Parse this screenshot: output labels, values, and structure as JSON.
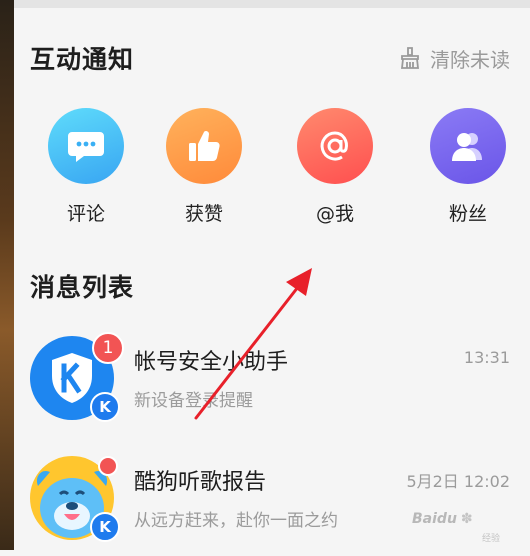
{
  "interactions": {
    "title": "互动通知",
    "clear_label": "清除未读",
    "items": [
      {
        "label": "评论",
        "icon": "comment-icon",
        "color_from": "#5fdcfb",
        "color_to": "#38a5f2"
      },
      {
        "label": "获赞",
        "icon": "thumbs-up-icon",
        "color_from": "#ffb25c",
        "color_to": "#ff8a3a"
      },
      {
        "label": "@我",
        "icon": "at-icon",
        "color_from": "#ff8a6e",
        "color_to": "#ff4f4f"
      },
      {
        "label": "粉丝",
        "icon": "fans-icon",
        "color_from": "#8b7bf5",
        "color_to": "#6a55e8"
      }
    ]
  },
  "messages": {
    "title": "消息列表",
    "items": [
      {
        "name": "帐号安全小助手",
        "preview": "新设备登录提醒",
        "time": "13:31",
        "badge": "1",
        "avatar_icon": "shield-icon"
      },
      {
        "name": "酷狗听歌报告",
        "preview": "从远方赶来，赴你一面之约",
        "time": "5月2日 12:02",
        "avatar_icon": "dog-mascot-icon"
      }
    ],
    "k_letter": "K"
  },
  "watermark": {
    "text": "Baidu",
    "sub": "经验"
  },
  "colors": {
    "accent": "#1e7bee",
    "badge": "#f25454",
    "muted": "#9b9b9b",
    "annotation_arrow": "#e8202a"
  }
}
